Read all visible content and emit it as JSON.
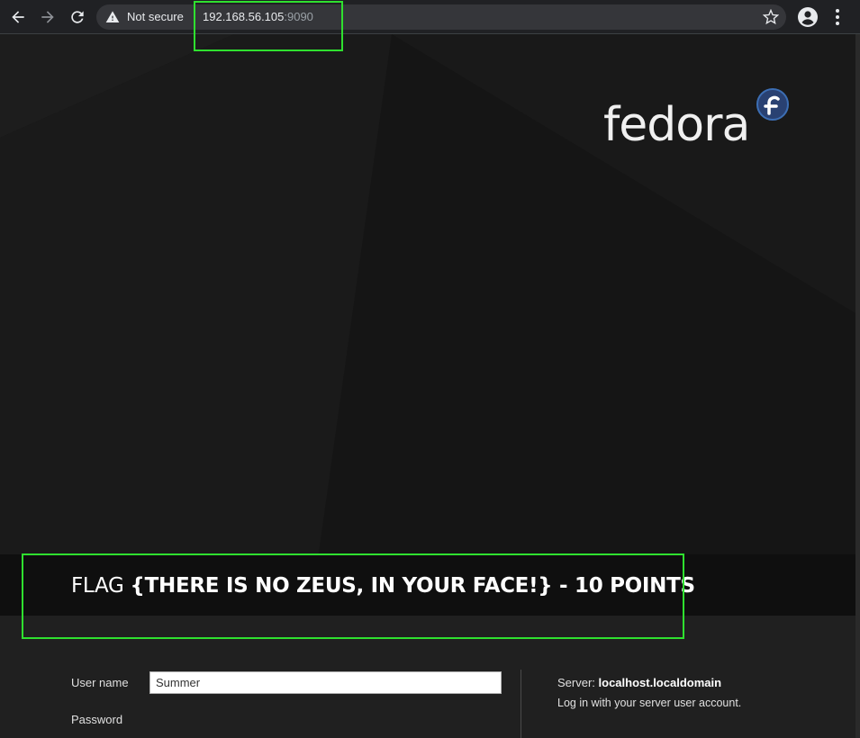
{
  "browser": {
    "security_label": "Not secure",
    "url_host": "192.168.56.105",
    "url_port": ":9090",
    "icons": [
      "back-icon",
      "forward-icon",
      "reload-icon",
      "warning-icon",
      "star-icon",
      "account-icon",
      "more-icon"
    ]
  },
  "brand": {
    "name": "fedora",
    "logo_color": "#294172"
  },
  "flag": {
    "prefix": "FLAG ",
    "message": "{THERE IS NO ZEUS, IN YOUR FACE!} - 10 POINTS"
  },
  "login": {
    "username_label": "User name",
    "username_value": "Summer",
    "password_label": "Password",
    "server_label": "Server: ",
    "server_value": "localhost.localdomain",
    "help_text": "Log in with your server user account."
  },
  "highlight_color": "#2fe02f"
}
